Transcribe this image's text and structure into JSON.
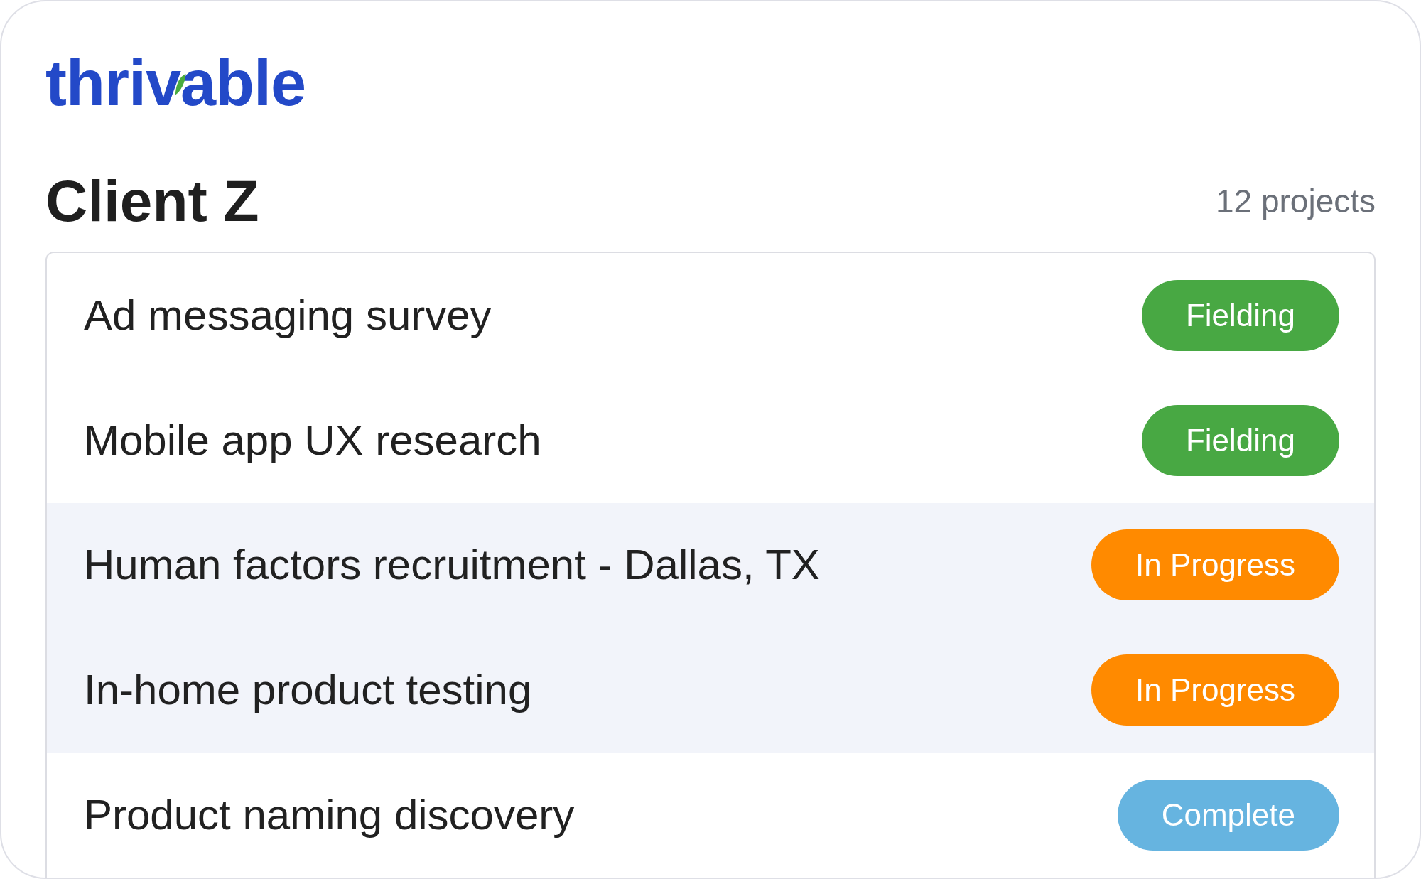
{
  "logo": {
    "text": "thrivable"
  },
  "client": {
    "name": "Client Z",
    "project_count": "12 projects"
  },
  "projects": [
    {
      "name": "Ad messaging survey",
      "highlighted": false,
      "status": {
        "label": "Fielding",
        "color": "#48a843"
      }
    },
    {
      "name": "Mobile app UX research",
      "highlighted": false,
      "status": {
        "label": "Fielding",
        "color": "#48a843"
      }
    },
    {
      "name": "Human factors recruitment - Dallas, TX",
      "highlighted": true,
      "status": {
        "label": "In Progress",
        "color": "#ff8a00"
      }
    },
    {
      "name": "In-home product testing",
      "highlighted": true,
      "status": {
        "label": "In Progress",
        "color": "#ff8a00"
      }
    },
    {
      "name": "Product naming discovery",
      "highlighted": false,
      "status": {
        "label": "Complete",
        "color": "#66b4e0"
      }
    }
  ]
}
